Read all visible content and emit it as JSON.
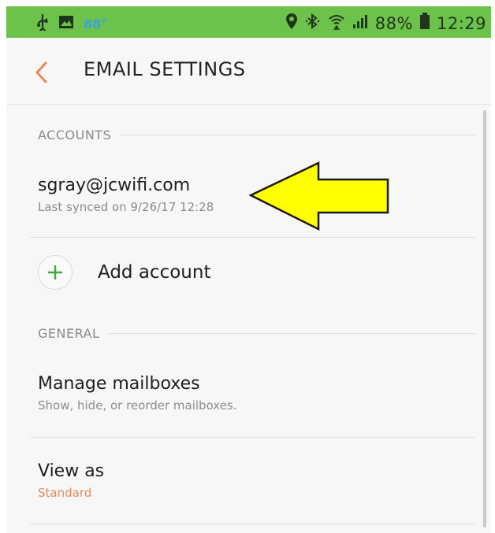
{
  "status_bar": {
    "temperature": "88°",
    "battery_percent": "88%",
    "time": "12:29",
    "icons": [
      "usb-icon",
      "image-icon",
      "location-icon",
      "bluetooth-icon",
      "wifi-icon",
      "signal-icon",
      "battery-icon"
    ]
  },
  "header": {
    "title": "EMAIL SETTINGS",
    "back_icon": "chevron-left-icon"
  },
  "accounts": {
    "section_label": "ACCOUNTS",
    "account_email": "sgray@jcwifi.com",
    "last_synced": "Last synced on 9/26/17 12:28",
    "add_label": "Add account"
  },
  "general": {
    "section_label": "GENERAL",
    "manage_title": "Manage mailboxes",
    "manage_sub": "Show, hide, or reorder mailboxes.",
    "view_title": "View as",
    "view_value": "Standard"
  },
  "colors": {
    "status_bar_green": "#6cc24a",
    "accent_orange": "#e8885a",
    "plus_green": "#3fae3f",
    "arrow_yellow": "#ffff00"
  }
}
